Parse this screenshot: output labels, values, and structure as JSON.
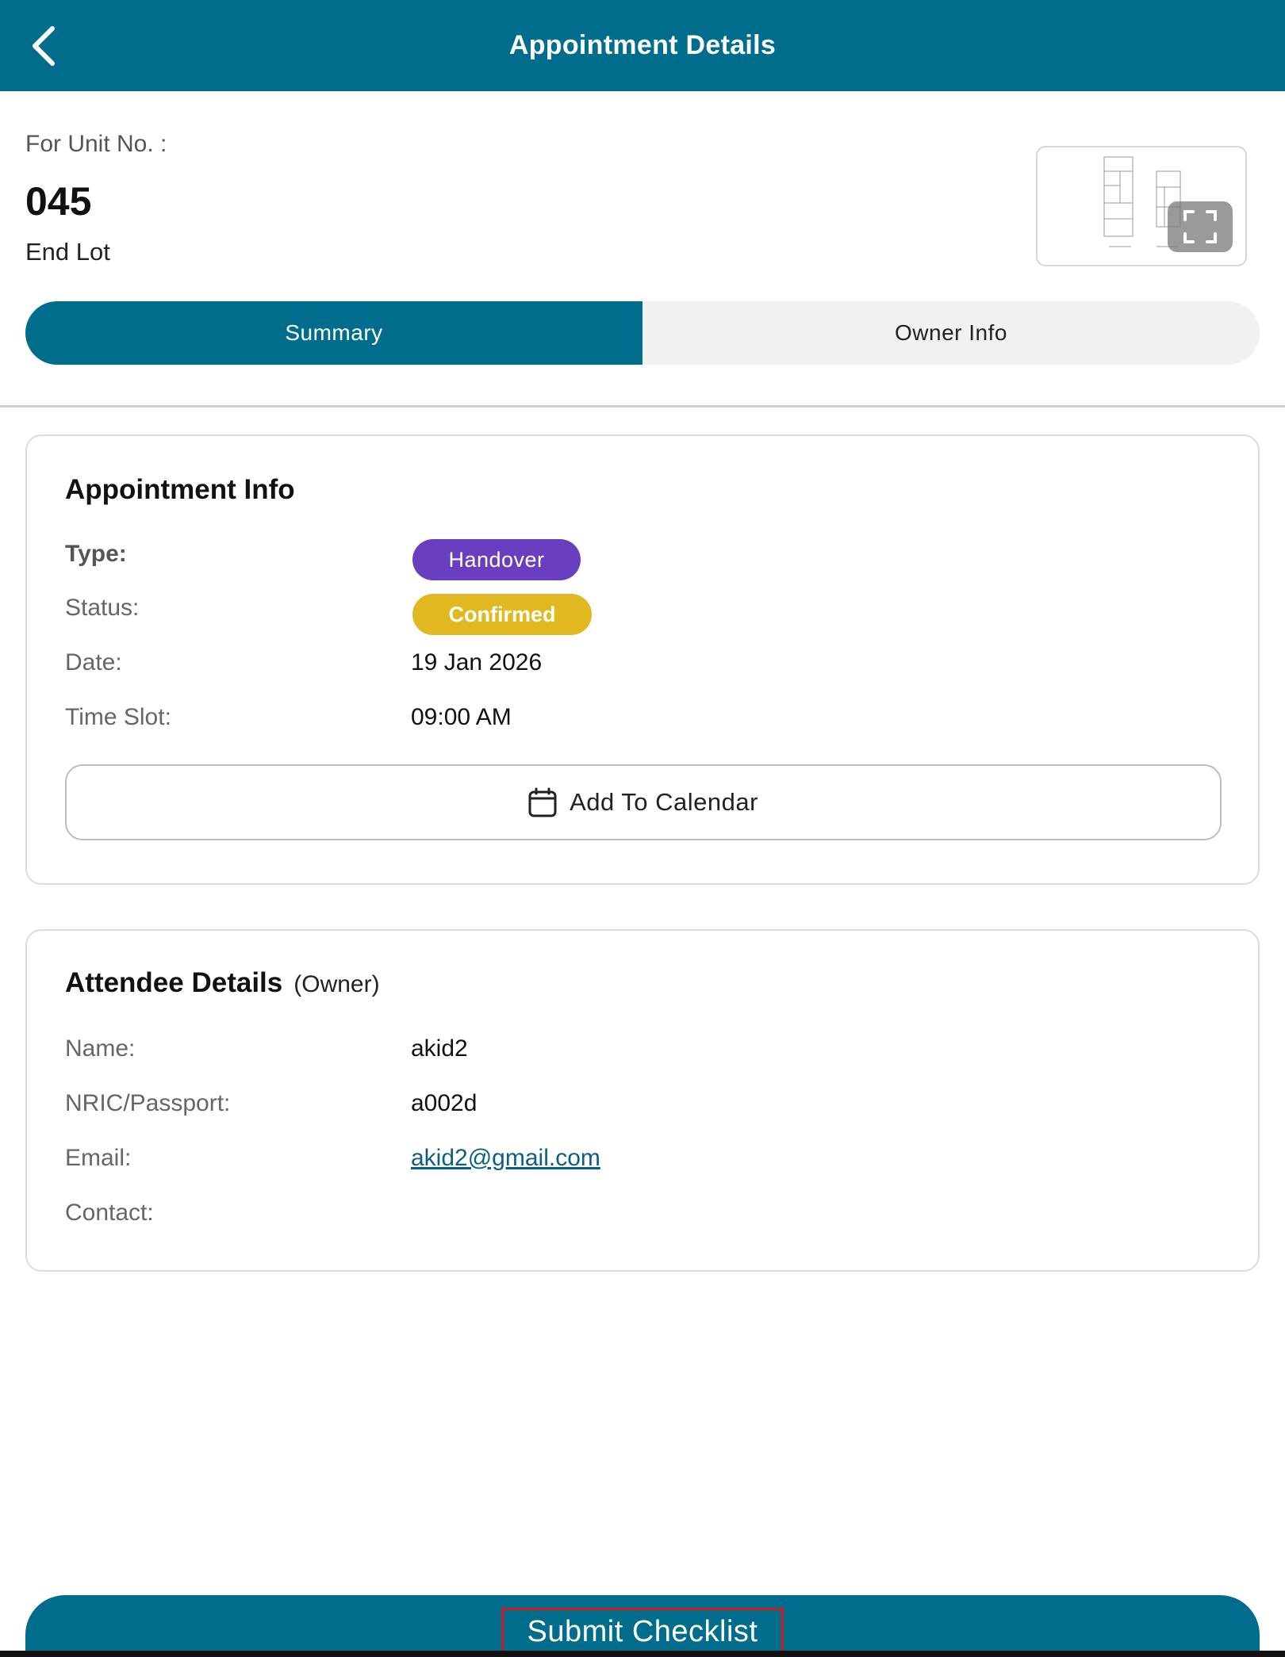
{
  "header": {
    "title": "Appointment Details",
    "back_icon": "chevron-left-icon"
  },
  "unit": {
    "label": "For Unit No. :",
    "number": "045",
    "type": "End Lot"
  },
  "floorplan": {
    "expand_icon": "expand-icon"
  },
  "tabs": [
    {
      "label": "Summary",
      "active": true
    },
    {
      "label": "Owner Info",
      "active": false
    }
  ],
  "appointment": {
    "title": "Appointment Info",
    "type_label": "Type:",
    "type_value": "Handover",
    "status_label": "Status:",
    "status_value": "Confirmed",
    "date_label": "Date:",
    "date_value": "19 Jan 2026",
    "time_label": "Time Slot:",
    "time_value": "09:00 AM",
    "calendar_button": "Add To Calendar",
    "calendar_icon": "calendar-icon"
  },
  "attendee": {
    "title": "Attendee Details",
    "role": "(Owner)",
    "name_label": "Name:",
    "name_value": "akid2",
    "nric_label": "NRIC/Passport:",
    "nric_value": "a002d",
    "email_label": "Email:",
    "email_value": "akid2@gmail.com",
    "contact_label": "Contact:",
    "contact_value": ""
  },
  "submit": {
    "label": "Submit Checklist"
  },
  "colors": {
    "primary": "#006d8d",
    "handover_badge": "#6a3fbf",
    "confirmed_badge": "#e0b820",
    "highlight_border": "#d0191c"
  }
}
